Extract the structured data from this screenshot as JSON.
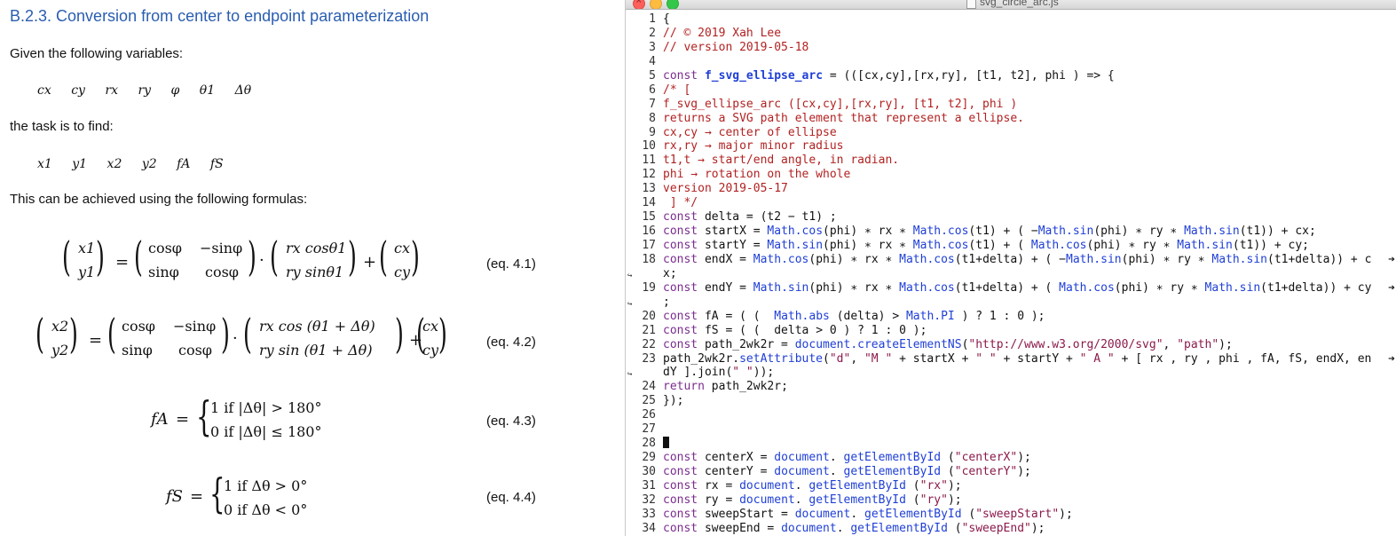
{
  "document": {
    "title": "B.2.3. Conversion from center to endpoint parameterization",
    "given_text": "Given the following variables:",
    "given_vars": [
      "cx",
      "cy",
      "rx",
      "ry",
      "φ",
      "θ1",
      "Δθ"
    ],
    "task_text": "the task is to find:",
    "find_vars": [
      "x1",
      "y1",
      "x2",
      "y2",
      "fA",
      "fS"
    ],
    "formulas_text": "This can be achieved using the following formulas:",
    "equations": [
      {
        "label": "(eq. 4.1)"
      },
      {
        "label": "(eq. 4.2)"
      },
      {
        "label": "(eq. 4.3)"
      },
      {
        "label": "(eq. 4.4)"
      }
    ],
    "eq41": {
      "lhs_top": "x1",
      "lhs_bot": "y1",
      "m11": "cosφ",
      "m12": "−sinφ",
      "m21": "sinφ",
      "m22": "cosφ",
      "v_top": "rx cosθ1",
      "v_bot": "ry sinθ1",
      "c_top": "cx",
      "c_bot": "cy"
    },
    "eq42": {
      "lhs_top": "x2",
      "lhs_bot": "y2",
      "m11": "cosφ",
      "m12": "−sinφ",
      "m21": "sinφ",
      "m22": "cosφ",
      "v_top": "rx cos (θ1 + Δθ)",
      "v_bot": "ry sin (θ1 + Δθ)",
      "c_top": "cx",
      "c_bot": "cy"
    },
    "eq43": {
      "lhs": "fA",
      "case1": "1  if  |Δθ| > 180°",
      "case2": "0  if  |Δθ| ≤ 180°"
    },
    "eq44": {
      "lhs": "fS",
      "case1": "1  if  Δθ > 0°",
      "case2": "0  if  Δθ < 0°"
    }
  },
  "editor": {
    "window_title": "svg_circle_arc.js",
    "lines": [
      {
        "n": "1",
        "parts": [
          [
            "",
            "{"
          ]
        ]
      },
      {
        "n": "2",
        "parts": [
          [
            "cm",
            "// © 2019 Xah Lee"
          ]
        ]
      },
      {
        "n": "3",
        "parts": [
          [
            "cm",
            "// version 2019-05-18"
          ]
        ]
      },
      {
        "n": "4",
        "parts": []
      },
      {
        "n": "5",
        "parts": [
          [
            "kw",
            "const "
          ],
          [
            "fn",
            "f_svg_ellipse_arc"
          ],
          [
            "",
            " = (([cx,cy],[rx,ry], [t1, t2], phi ) => {"
          ]
        ]
      },
      {
        "n": "6",
        "parts": [
          [
            "cm",
            "/* ["
          ]
        ]
      },
      {
        "n": "7",
        "parts": [
          [
            "cm",
            "f_svg_ellipse_arc ([cx,cy],[rx,ry], [t1, t2], phi )"
          ]
        ]
      },
      {
        "n": "8",
        "parts": [
          [
            "cm",
            "returns a SVG path element that represent a ellipse."
          ]
        ]
      },
      {
        "n": "9",
        "parts": [
          [
            "cm",
            "cx,cy → center of ellipse"
          ]
        ]
      },
      {
        "n": "10",
        "parts": [
          [
            "cm",
            "rx,ry → major minor radius"
          ]
        ]
      },
      {
        "n": "11",
        "parts": [
          [
            "cm",
            "t1,t → start/end angle, in radian."
          ]
        ]
      },
      {
        "n": "12",
        "parts": [
          [
            "cm",
            "phi → rotation on the whole"
          ]
        ]
      },
      {
        "n": "13",
        "parts": [
          [
            "cm",
            "version 2019-05-17"
          ]
        ]
      },
      {
        "n": "14",
        "parts": [
          [
            "cm",
            " ] */"
          ]
        ]
      },
      {
        "n": "15",
        "parts": [
          [
            "kw",
            "const "
          ],
          [
            "",
            "delta = (t2 − t1) ;"
          ]
        ]
      },
      {
        "n": "16",
        "parts": [
          [
            "kw",
            "const "
          ],
          [
            "",
            "startX = "
          ],
          [
            "bi",
            "Math.cos"
          ],
          [
            "",
            "(phi) ∗ rx ∗ "
          ],
          [
            "bi",
            "Math.cos"
          ],
          [
            "",
            "(t1) + ( −"
          ],
          [
            "bi",
            "Math.sin"
          ],
          [
            "",
            "(phi) ∗ ry ∗ "
          ],
          [
            "bi",
            "Math.sin"
          ],
          [
            "",
            "(t1)) + cx;"
          ]
        ]
      },
      {
        "n": "17",
        "parts": [
          [
            "kw",
            "const "
          ],
          [
            "",
            "startY = "
          ],
          [
            "bi",
            "Math.sin"
          ],
          [
            "",
            "(phi) ∗ rx ∗ "
          ],
          [
            "bi",
            "Math.cos"
          ],
          [
            "",
            "(t1) + ( "
          ],
          [
            "bi",
            "Math.cos"
          ],
          [
            "",
            "(phi) ∗ ry ∗ "
          ],
          [
            "bi",
            "Math.sin"
          ],
          [
            "",
            "(t1)) + cy;"
          ]
        ]
      },
      {
        "n": "18",
        "parts": [
          [
            "kw",
            "const "
          ],
          [
            "",
            "endX = "
          ],
          [
            "bi",
            "Math.cos"
          ],
          [
            "",
            "(phi) ∗ rx ∗ "
          ],
          [
            "bi",
            "Math.cos"
          ],
          [
            "",
            "(t1+delta) + ( −"
          ],
          [
            "bi",
            "Math.sin"
          ],
          [
            "",
            "(phi) ∗ ry ∗ "
          ],
          [
            "bi",
            "Math.sin"
          ],
          [
            "",
            "(t1+delta)) + c"
          ]
        ],
        "trunc": "➔"
      },
      {
        "n": "",
        "wrap": true,
        "parts": [
          [
            "",
            "x;"
          ]
        ]
      },
      {
        "n": "19",
        "parts": [
          [
            "kw",
            "const "
          ],
          [
            "",
            "endY = "
          ],
          [
            "bi",
            "Math.sin"
          ],
          [
            "",
            "(phi) ∗ rx ∗ "
          ],
          [
            "bi",
            "Math.cos"
          ],
          [
            "",
            "(t1+delta) + ( "
          ],
          [
            "bi",
            "Math.cos"
          ],
          [
            "",
            "(phi) ∗ ry ∗ "
          ],
          [
            "bi",
            "Math.sin"
          ],
          [
            "",
            "(t1+delta)) + cy"
          ]
        ],
        "trunc": "➔"
      },
      {
        "n": "",
        "wrap": true,
        "parts": [
          [
            "",
            ";"
          ]
        ]
      },
      {
        "n": "20",
        "parts": [
          [
            "kw",
            "const "
          ],
          [
            "",
            "fA = ( (  "
          ],
          [
            "bi",
            "Math.abs"
          ],
          [
            "",
            " (delta) > "
          ],
          [
            "bi",
            "Math.PI"
          ],
          [
            "",
            " ) ? 1 : 0 );"
          ]
        ]
      },
      {
        "n": "21",
        "parts": [
          [
            "kw",
            "const "
          ],
          [
            "",
            "fS = ( (  delta > 0 ) ? 1 : 0 );"
          ]
        ]
      },
      {
        "n": "22",
        "parts": [
          [
            "kw",
            "const "
          ],
          [
            "",
            "path_2wk2r = "
          ],
          [
            "bi",
            "document.createElementNS"
          ],
          [
            "",
            "("
          ],
          [
            "str",
            "\"http://www.w3.org/2000/svg\""
          ],
          [
            "",
            ", "
          ],
          [
            "str",
            "\"path\""
          ],
          [
            "",
            ");"
          ]
        ]
      },
      {
        "n": "23",
        "parts": [
          [
            "",
            "path_2wk2r."
          ],
          [
            "bi",
            "setAttribute"
          ],
          [
            "",
            "("
          ],
          [
            "str",
            "\"d\""
          ],
          [
            "",
            ", "
          ],
          [
            "str",
            "\"M \""
          ],
          [
            "",
            " + startX + "
          ],
          [
            "str",
            "\" \""
          ],
          [
            "",
            " + startY + "
          ],
          [
            "str",
            "\" A \""
          ],
          [
            "",
            " + [ rx , ry , phi , fA, fS, endX, en"
          ]
        ],
        "trunc": "➔"
      },
      {
        "n": "",
        "wrap": true,
        "parts": [
          [
            "",
            "dY ].join("
          ],
          [
            "str",
            "\" \""
          ],
          [
            "",
            "));"
          ]
        ]
      },
      {
        "n": "24",
        "parts": [
          [
            "kw",
            "return "
          ],
          [
            "",
            "path_2wk2r;"
          ]
        ]
      },
      {
        "n": "25",
        "parts": [
          [
            "",
            "});"
          ]
        ]
      },
      {
        "n": "26",
        "parts": []
      },
      {
        "n": "27",
        "parts": []
      },
      {
        "n": "28",
        "parts": [],
        "cursor": true
      },
      {
        "n": "29",
        "parts": [
          [
            "kw",
            "const "
          ],
          [
            "",
            "centerX = "
          ],
          [
            "bi",
            "document"
          ],
          [
            "",
            ". "
          ],
          [
            "bi",
            "getElementById"
          ],
          [
            "",
            " ("
          ],
          [
            "str",
            "\"centerX\""
          ],
          [
            "",
            ");"
          ]
        ]
      },
      {
        "n": "30",
        "parts": [
          [
            "kw",
            "const "
          ],
          [
            "",
            "centerY = "
          ],
          [
            "bi",
            "document"
          ],
          [
            "",
            ". "
          ],
          [
            "bi",
            "getElementById"
          ],
          [
            "",
            " ("
          ],
          [
            "str",
            "\"centerY\""
          ],
          [
            "",
            ");"
          ]
        ]
      },
      {
        "n": "31",
        "parts": [
          [
            "kw",
            "const "
          ],
          [
            "",
            "rx = "
          ],
          [
            "bi",
            "document"
          ],
          [
            "",
            ". "
          ],
          [
            "bi",
            "getElementById"
          ],
          [
            "",
            " ("
          ],
          [
            "str",
            "\"rx\""
          ],
          [
            "",
            ");"
          ]
        ]
      },
      {
        "n": "32",
        "parts": [
          [
            "kw",
            "const "
          ],
          [
            "",
            "ry = "
          ],
          [
            "bi",
            "document"
          ],
          [
            "",
            ". "
          ],
          [
            "bi",
            "getElementById"
          ],
          [
            "",
            " ("
          ],
          [
            "str",
            "\"ry\""
          ],
          [
            "",
            ");"
          ]
        ]
      },
      {
        "n": "33",
        "parts": [
          [
            "kw",
            "const "
          ],
          [
            "",
            "sweepStart = "
          ],
          [
            "bi",
            "document"
          ],
          [
            "",
            ". "
          ],
          [
            "bi",
            "getElementById"
          ],
          [
            "",
            " ("
          ],
          [
            "str",
            "\"sweepStart\""
          ],
          [
            "",
            ");"
          ]
        ]
      },
      {
        "n": "34",
        "parts": [
          [
            "kw",
            "const "
          ],
          [
            "",
            "sweepEnd = "
          ],
          [
            "bi",
            "document"
          ],
          [
            "",
            ". "
          ],
          [
            "bi",
            "getElementById"
          ],
          [
            "",
            " ("
          ],
          [
            "str",
            "\"sweepEnd\""
          ],
          [
            "",
            ");"
          ]
        ]
      }
    ]
  }
}
